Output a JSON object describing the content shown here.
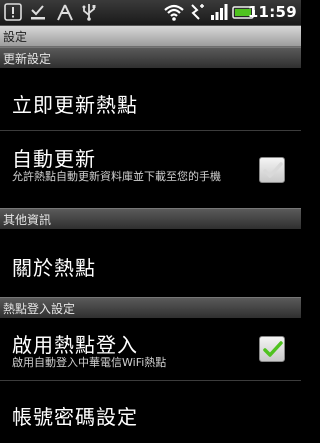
{
  "status_bar": {
    "time": "11:59",
    "icons": [
      "warning-icon",
      "download-complete-icon",
      "wifi-hotspot-icon",
      "usb-icon",
      "wifi-signal-icon",
      "vibrate-icon",
      "cell-signal-icon",
      "battery-icon"
    ],
    "battery_color": "#4fc21f"
  },
  "title": "設定",
  "categories": {
    "update": "更新設定",
    "other": "其他資訊",
    "login": "熱點登入設定"
  },
  "items": {
    "update_now": {
      "title": "立即更新熱點"
    },
    "auto_update": {
      "title": "自動更新",
      "summary": "允許熱點自動更新資料庫並下載至您的手機",
      "checked": false
    },
    "about": {
      "title": "關於熱點"
    },
    "enable_login": {
      "title": "啟用熱點登入",
      "summary": "啟用自動登入中華電信WiFi熱點",
      "checked": true
    },
    "account": {
      "title": "帳號密碼設定"
    }
  },
  "colors": {
    "check_on": "#4fc21f",
    "check_off": "#d9d9d9"
  }
}
